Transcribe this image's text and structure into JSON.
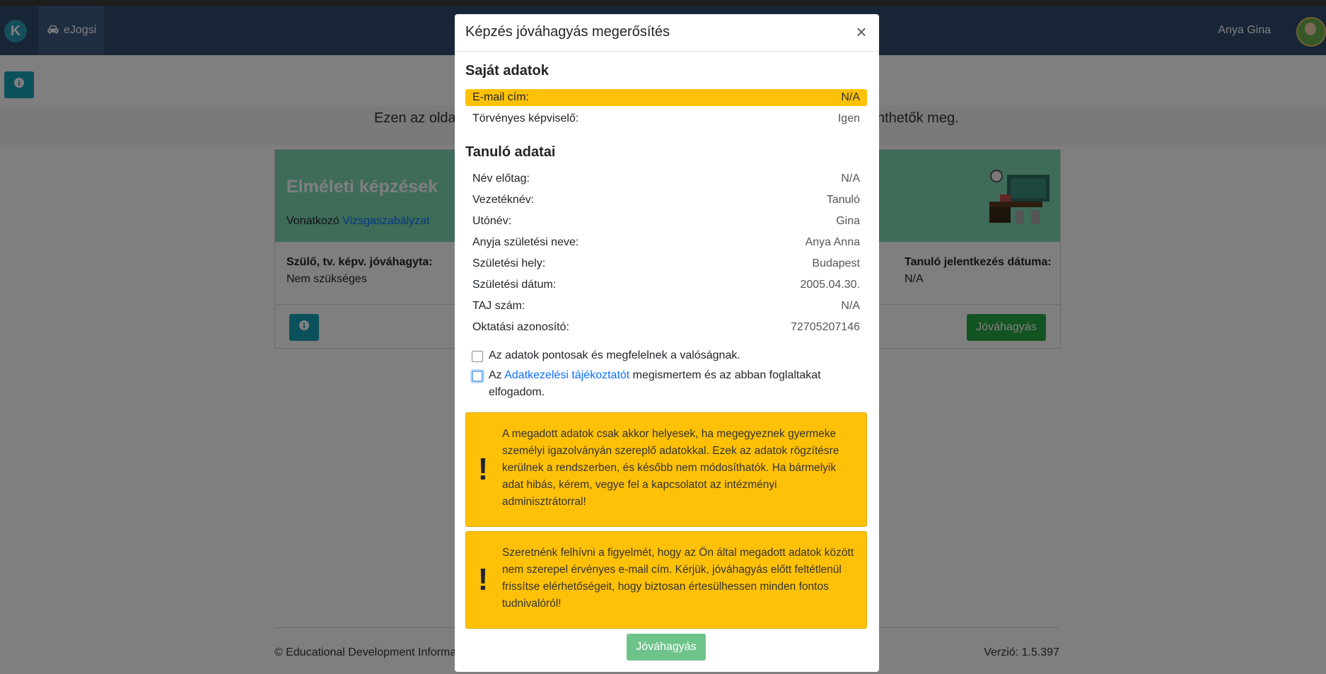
{
  "navbar": {
    "logo_letter": "K",
    "nav_item_label": "eJogsi",
    "username": "Anya Gina"
  },
  "page": {
    "intro_text": "Ezen az oldal",
    "intro_text_end": "nthetők meg.",
    "card": {
      "title": "Elméleti képzések",
      "sub_prefix": "Vonatkozó ",
      "sub_link": "Vizsgaszabályzat",
      "col1_label": "Szülő, tv. képv. jóváhagyta:",
      "col1_value": "Nem szükséges",
      "col2_label": "Tanuló jelentkezés dátuma:",
      "col2_value": "N/A",
      "approve_label": "Jóváhagyás"
    },
    "footer_left": "© Educational Development Informa",
    "footer_right": "Verzió: 1.5.397"
  },
  "modal": {
    "title": "Képzés jóváhagyás megerősítés",
    "close_glyph": "×",
    "own_section_title": "Saját adatok",
    "own_rows": [
      {
        "label": "E-mail cím:",
        "value": "N/A"
      },
      {
        "label": "Törvényes képviselő:",
        "value": "Igen"
      }
    ],
    "student_section_title": "Tanuló adatai",
    "student_rows": [
      {
        "label": "Név előtag:",
        "value": "N/A"
      },
      {
        "label": "Vezetéknév:",
        "value": "Tanuló"
      },
      {
        "label": "Utónév:",
        "value": "Gina"
      },
      {
        "label": "Anyja születési neve:",
        "value": "Anya Anna"
      },
      {
        "label": "Születési hely:",
        "value": "Budapest"
      },
      {
        "label": "Születési dátum:",
        "value": "2005.04.30."
      },
      {
        "label": "TAJ szám:",
        "value": "N/A"
      },
      {
        "label": "Oktatási azonosító:",
        "value": "72705207146"
      }
    ],
    "check1_text": "Az adatok pontosak és megfelelnek a valóságnak.",
    "check2_prefix": "Az ",
    "check2_link": "Adatkezelési tájékoztatót",
    "check2_suffix": " megismertem és az abban foglaltakat elfogadom.",
    "alert1_text": "A megadott adatok csak akkor helyesek, ha megegyeznek gyermeke személyi igazolványán szereplő adatokkal. Ezek az adatok rögzítésre kerülnek a rendszerben, és később nem módosíthatók. Ha bármelyik adat hibás, kérem, vegye fel a kapcsolatot az intézményi adminisztrátorral!",
    "alert2_text": "Szeretnénk felhívni a figyelmét, hogy az Ön által megadott adatok között nem szerepel érvényes e-mail cím. Kérjük, jóváhagyás előtt feltétlenül frissítse elérhetőségeit, hogy biztosan értesülhessen minden fontos tudnivalóról!",
    "alert_glyph": "!",
    "approve_label": "Jóváhagyás"
  },
  "colors": {
    "navbar": "#2f4a6e",
    "card_header": "#7dd8b3",
    "warning": "#ffc107",
    "success": "#28a745",
    "info": "#17a2b8",
    "link": "#0d6efd"
  },
  "icons": [
    "logo-icon",
    "car-icon",
    "user-avatar",
    "info-icon",
    "close-icon",
    "exclamation-icon",
    "classroom-illustration"
  ]
}
